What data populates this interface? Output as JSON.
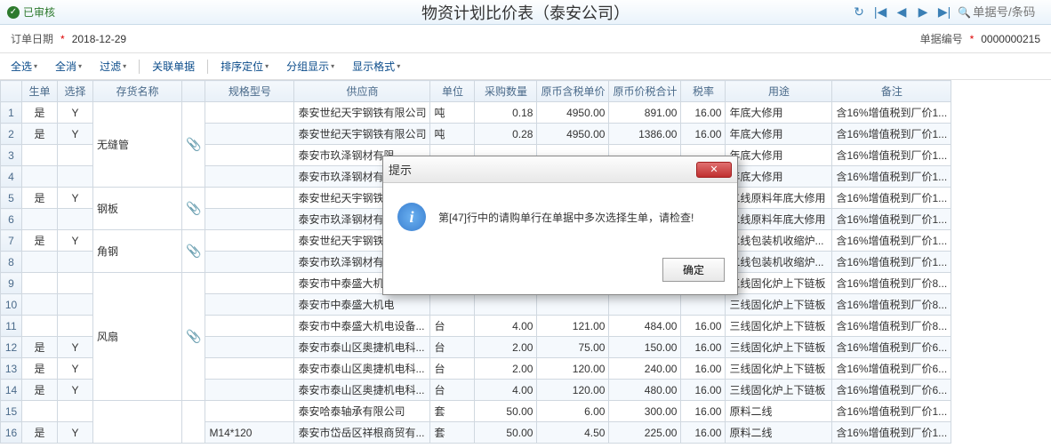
{
  "status": "已审核",
  "title": "物资计划比价表（泰安公司）",
  "search_placeholder": "单据号/条码",
  "form": {
    "order_date_label": "订单日期",
    "order_date": "2018-12-29",
    "doc_no_label": "单据编号",
    "doc_no": "0000000215"
  },
  "actions": {
    "select_all": "全选",
    "deselect_all": "全消",
    "filter": "过滤",
    "related": "关联单据",
    "sort": "排序定位",
    "group": "分组显示",
    "display": "显示格式"
  },
  "cols": {
    "rn": "",
    "sd": "生单",
    "xz": "选择",
    "hm": "存货名称",
    "at": "",
    "gg": "规格型号",
    "gys": "供应商",
    "dw": "单位",
    "qty": "采购数量",
    "up": "原币含税单价",
    "tot": "原币价税合计",
    "tax": "税率",
    "use": "用途",
    "rem": "备注"
  },
  "groups": [
    {
      "name": "无缝管",
      "rows": [
        {
          "rn": "1",
          "sd": "是",
          "xz": "Y",
          "gg": "",
          "gys": "泰安世纪天宇钢铁有限公司",
          "dw": "吨",
          "qty": "0.18",
          "up": "4950.00",
          "tot": "891.00",
          "tax": "16.00",
          "use": "年底大修用",
          "rem": "含16%增值税到厂价1..."
        },
        {
          "rn": "2",
          "sd": "是",
          "xz": "Y",
          "gg": "",
          "gys": "泰安世纪天宇钢铁有限公司",
          "dw": "吨",
          "qty": "0.28",
          "up": "4950.00",
          "tot": "1386.00",
          "tax": "16.00",
          "use": "年底大修用",
          "rem": "含16%增值税到厂价1..."
        },
        {
          "rn": "3",
          "sd": "",
          "xz": "",
          "gg": "",
          "gys": "泰安市玖泽钢材有限",
          "dw": "",
          "qty": "",
          "up": "",
          "tot": "",
          "tax": "",
          "use": "年底大修用",
          "rem": "含16%增值税到厂价1..."
        },
        {
          "rn": "4",
          "sd": "",
          "xz": "",
          "gg": "",
          "gys": "泰安市玖泽钢材有限",
          "dw": "",
          "qty": "",
          "up": "",
          "tot": "",
          "tax": "",
          "use": "年底大修用",
          "rem": "含16%增值税到厂价1..."
        }
      ]
    },
    {
      "name": "钢板",
      "rows": [
        {
          "rn": "5",
          "sd": "是",
          "xz": "Y",
          "gg": "",
          "gys": "泰安世纪天宇钢铁有",
          "dw": "",
          "qty": "",
          "up": "",
          "tot": "",
          "tax": "",
          "use": "二线原料年底大修用",
          "rem": "含16%增值税到厂价1..."
        },
        {
          "rn": "6",
          "sd": "",
          "xz": "",
          "gg": "",
          "gys": "泰安市玖泽钢材有限",
          "dw": "",
          "qty": "",
          "up": "",
          "tot": "",
          "tax": "",
          "use": "二线原料年底大修用",
          "rem": "含16%增值税到厂价1..."
        }
      ]
    },
    {
      "name": "角钢",
      "rows": [
        {
          "rn": "7",
          "sd": "是",
          "xz": "Y",
          "gg": "",
          "gys": "泰安世纪天宇钢铁有",
          "dw": "",
          "qty": "",
          "up": "",
          "tot": "",
          "tax": "",
          "use": "二线包装机收缩炉...",
          "rem": "含16%增值税到厂价1..."
        },
        {
          "rn": "8",
          "sd": "",
          "xz": "",
          "gg": "",
          "gys": "泰安市玖泽钢材有限",
          "dw": "",
          "qty": "",
          "up": "",
          "tot": "",
          "tax": "",
          "use": "二线包装机收缩炉...",
          "rem": "含16%增值税到厂价1..."
        }
      ]
    },
    {
      "name": "风扇",
      "rows": [
        {
          "rn": "9",
          "sd": "",
          "xz": "",
          "gg": "",
          "gys": "泰安市中泰盛大机电",
          "dw": "",
          "qty": "",
          "up": "",
          "tot": "",
          "tax": "",
          "use": "三线固化炉上下链板",
          "rem": "含16%增值税到厂价8..."
        },
        {
          "rn": "10",
          "sd": "",
          "xz": "",
          "gg": "",
          "gys": "泰安市中泰盛大机电",
          "dw": "",
          "qty": "",
          "up": "",
          "tot": "",
          "tax": "",
          "use": "三线固化炉上下链板",
          "rem": "含16%增值税到厂价8..."
        },
        {
          "rn": "11",
          "sd": "",
          "xz": "",
          "gg": "",
          "gys": "泰安市中泰盛大机电设备...",
          "dw": "台",
          "qty": "4.00",
          "up": "121.00",
          "tot": "484.00",
          "tax": "16.00",
          "use": "三线固化炉上下链板",
          "rem": "含16%增值税到厂价8..."
        },
        {
          "rn": "12",
          "sd": "是",
          "xz": "Y",
          "gg": "",
          "gys": "泰安市泰山区奥捷机电科...",
          "dw": "台",
          "qty": "2.00",
          "up": "75.00",
          "tot": "150.00",
          "tax": "16.00",
          "use": "三线固化炉上下链板",
          "rem": "含16%增值税到厂价6..."
        },
        {
          "rn": "13",
          "sd": "是",
          "xz": "Y",
          "gg": "",
          "gys": "泰安市泰山区奥捷机电科...",
          "dw": "台",
          "qty": "2.00",
          "up": "120.00",
          "tot": "240.00",
          "tax": "16.00",
          "use": "三线固化炉上下链板",
          "rem": "含16%增值税到厂价6..."
        },
        {
          "rn": "14",
          "sd": "是",
          "xz": "Y",
          "gg": "",
          "gys": "泰安市泰山区奥捷机电科...",
          "dw": "台",
          "qty": "4.00",
          "up": "120.00",
          "tot": "480.00",
          "tax": "16.00",
          "use": "三线固化炉上下链板",
          "rem": "含16%增值税到厂价6..."
        }
      ]
    },
    {
      "name": "",
      "rows": [
        {
          "rn": "15",
          "sd": "",
          "xz": "",
          "gg": "",
          "gys": "泰安哈泰轴承有限公司",
          "dw": "套",
          "qty": "50.00",
          "up": "6.00",
          "tot": "300.00",
          "tax": "16.00",
          "use": "原料二线",
          "rem": "含16%增值税到厂价1..."
        },
        {
          "rn": "16",
          "sd": "是",
          "xz": "Y",
          "gg": "M14*120",
          "gys": "泰安市岱岳区祥根商贸有...",
          "dw": "套",
          "qty": "50.00",
          "up": "4.50",
          "tot": "225.00",
          "tax": "16.00",
          "use": "原料二线",
          "rem": "含16%增值税到厂价1..."
        }
      ]
    }
  ],
  "dialog": {
    "title": "提示",
    "message": "第[47]行中的请购单行在单据中多次选择生单，请检查!",
    "ok": "确定"
  },
  "attach_glyph": "📎"
}
